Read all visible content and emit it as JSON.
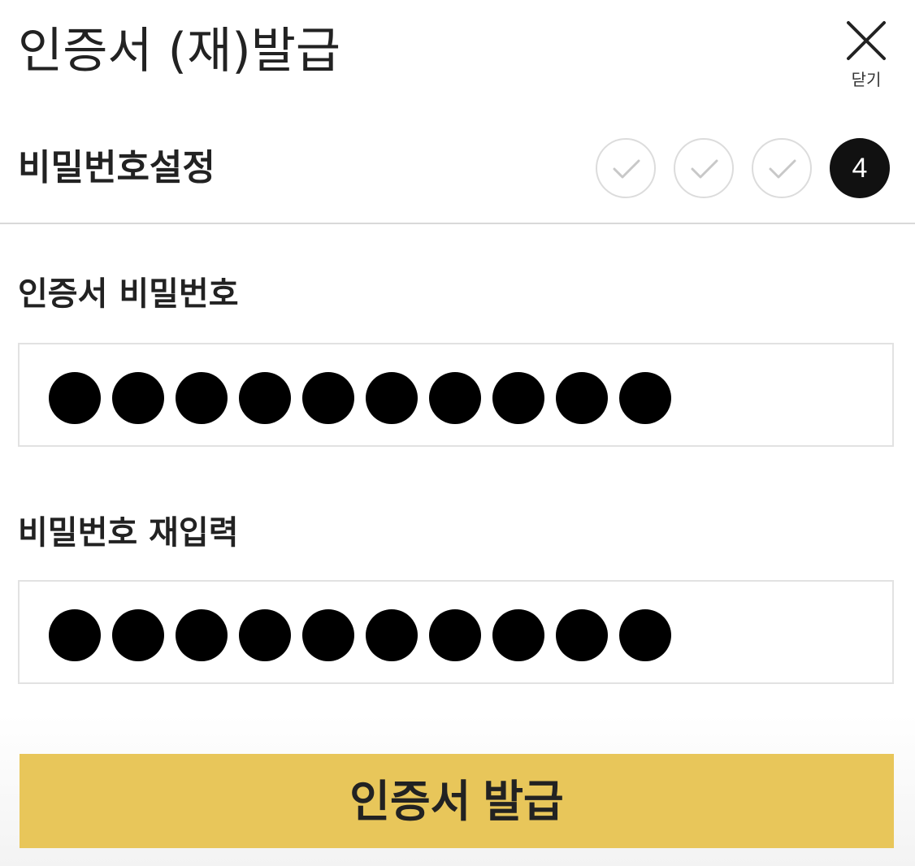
{
  "header": {
    "title": "인증서 (재)발급",
    "close_label": "닫기"
  },
  "step_section": {
    "title": "비밀번호설정",
    "steps": [
      {
        "state": "done",
        "icon": "check-icon"
      },
      {
        "state": "done",
        "icon": "check-icon"
      },
      {
        "state": "done",
        "icon": "check-icon"
      },
      {
        "state": "current",
        "label": "4"
      }
    ]
  },
  "form": {
    "password": {
      "label": "인증서 비밀번호",
      "masked_length": 10
    },
    "confirm": {
      "label": "비밀번호 재입력",
      "masked_length": 10
    }
  },
  "actions": {
    "submit_label": "인증서 발급"
  },
  "colors": {
    "accent": "#e8c65a",
    "current_step": "#111111",
    "done_step_border": "#dcdcdc",
    "divider": "#d9d9d9"
  }
}
